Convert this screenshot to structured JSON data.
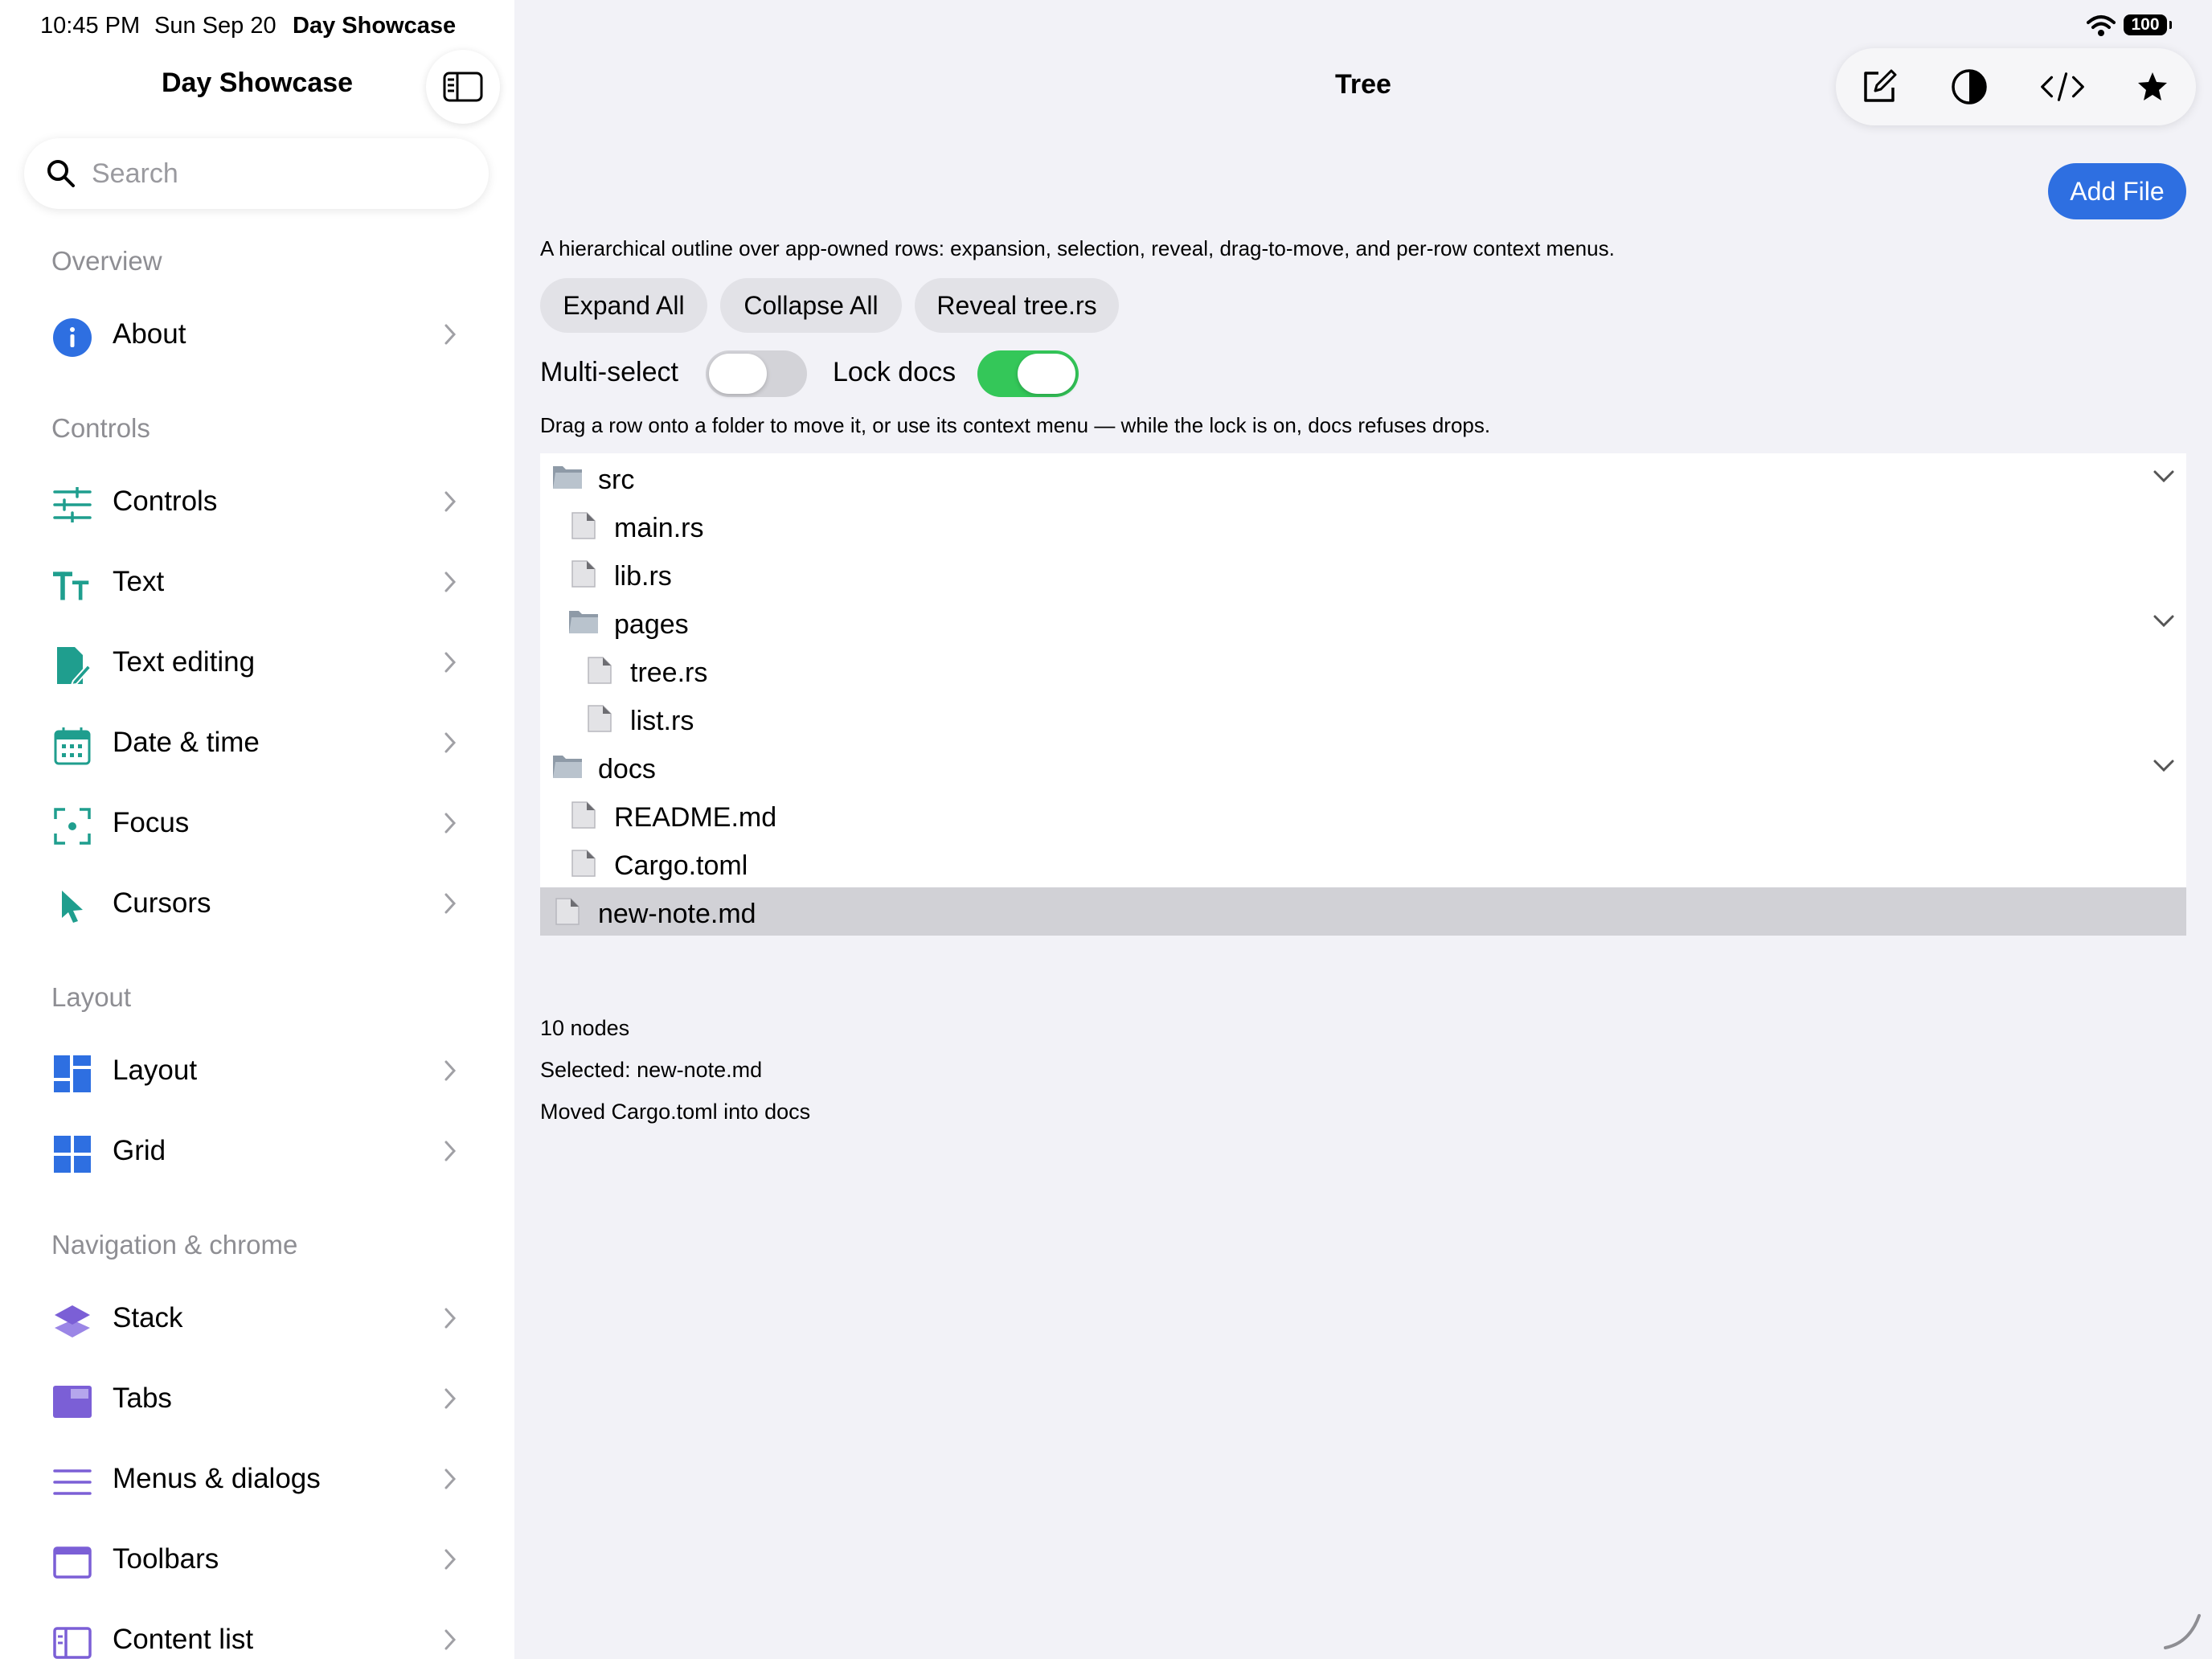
{
  "status_bar": {
    "time": "10:45 PM",
    "date": "Sun Sep 20",
    "app": "Day Showcase",
    "battery": "100"
  },
  "sidebar": {
    "title": "Day Showcase",
    "toggle_icon": "sidebar-icon",
    "search": {
      "placeholder": "Search",
      "value": ""
    },
    "sections": [
      {
        "header": "Overview",
        "items": [
          {
            "label": "About",
            "icon": "info-icon",
            "color": "#2e6fe1"
          }
        ]
      },
      {
        "header": "Controls",
        "items": [
          {
            "label": "Controls",
            "icon": "sliders-icon",
            "color": "#1f9e8e"
          },
          {
            "label": "Text",
            "icon": "text-size-icon",
            "color": "#1f9e8e"
          },
          {
            "label": "Text editing",
            "icon": "document-edit-icon",
            "color": "#1f9e8e"
          },
          {
            "label": "Date & time",
            "icon": "calendar-icon",
            "color": "#1f9e8e"
          },
          {
            "label": "Focus",
            "icon": "focus-icon",
            "color": "#1f9e8e"
          },
          {
            "label": "Cursors",
            "icon": "cursor-icon",
            "color": "#1f9e8e"
          }
        ]
      },
      {
        "header": "Layout",
        "items": [
          {
            "label": "Layout",
            "icon": "layout-icon",
            "color": "#2e6fe1"
          },
          {
            "label": "Grid",
            "icon": "grid-icon",
            "color": "#2e6fe1"
          }
        ]
      },
      {
        "header": "Navigation & chrome",
        "items": [
          {
            "label": "Stack",
            "icon": "stack-icon",
            "color": "#7b5fd6"
          },
          {
            "label": "Tabs",
            "icon": "tabs-icon",
            "color": "#7b5fd6"
          },
          {
            "label": "Menus & dialogs",
            "icon": "menu-lines-icon",
            "color": "#7b5fd6"
          },
          {
            "label": "Toolbars",
            "icon": "toolbar-icon",
            "color": "#7b5fd6"
          },
          {
            "label": "Content list",
            "icon": "content-list-icon",
            "color": "#7b5fd6"
          }
        ]
      }
    ]
  },
  "main": {
    "title": "Tree",
    "toolbar": [
      "compose-icon",
      "contrast-icon",
      "code-icon",
      "star-icon"
    ],
    "add_file_label": "Add File",
    "description": "A hierarchical outline over app-owned rows: expansion, selection, reveal, drag-to-move, and per-row context menus.",
    "actions": [
      "Expand All",
      "Collapse All",
      "Reveal tree.rs"
    ],
    "toggles": [
      {
        "label": "Multi-select",
        "on": false
      },
      {
        "label": "Lock docs",
        "on": true
      }
    ],
    "hint": "Drag a row onto a folder to move it, or use its context menu — while the lock is on, docs refuses drops.",
    "tree": [
      {
        "name": "src",
        "type": "folder",
        "depth": 0,
        "expanded": true
      },
      {
        "name": "main.rs",
        "type": "file",
        "depth": 1
      },
      {
        "name": "lib.rs",
        "type": "file",
        "depth": 1
      },
      {
        "name": "pages",
        "type": "folder",
        "depth": 1,
        "expanded": true
      },
      {
        "name": "tree.rs",
        "type": "file",
        "depth": 2
      },
      {
        "name": "list.rs",
        "type": "file",
        "depth": 2
      },
      {
        "name": "docs",
        "type": "folder",
        "depth": 0,
        "expanded": true
      },
      {
        "name": "README.md",
        "type": "file",
        "depth": 1
      },
      {
        "name": "Cargo.toml",
        "type": "file",
        "depth": 1
      },
      {
        "name": "new-note.md",
        "type": "file",
        "depth": 0,
        "selected": true
      }
    ],
    "info": {
      "count": "10 nodes",
      "selected": "Selected: new-note.md",
      "last_action": "Moved Cargo.toml into docs"
    }
  }
}
